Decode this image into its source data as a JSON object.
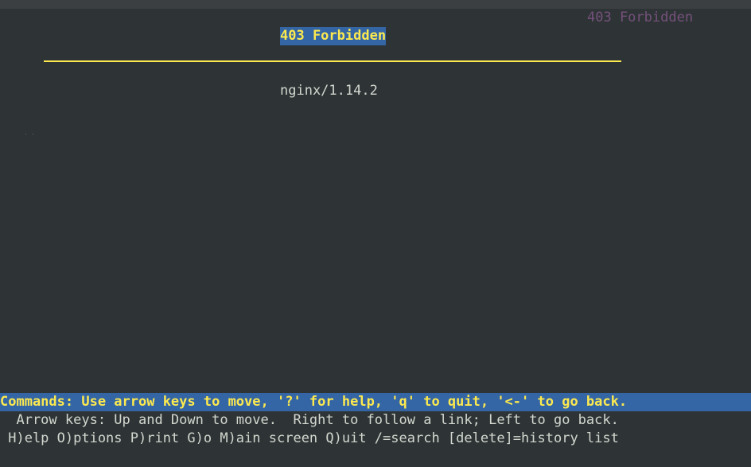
{
  "document": {
    "corner_title": "403 Forbidden",
    "heading": "403 Forbidden",
    "server_signature": "nginx/1.14.2"
  },
  "status_bar": {
    "text": "Commands: Use arrow keys to move, '?' for help, 'q' to quit, '<-' to go back."
  },
  "help": {
    "line1": "  Arrow keys: Up and Down to move.  Right to follow a link; Left to go back.",
    "line2": " H)elp O)ptions P)rint G)o M)ain screen Q)uit /=search [delete]=history list"
  },
  "colors": {
    "background": "#2e3436",
    "text": "#d3d7cf",
    "highlight_bg": "#3465a4",
    "highlight_fg": "#fce94f",
    "title_fg": "#75507b"
  }
}
